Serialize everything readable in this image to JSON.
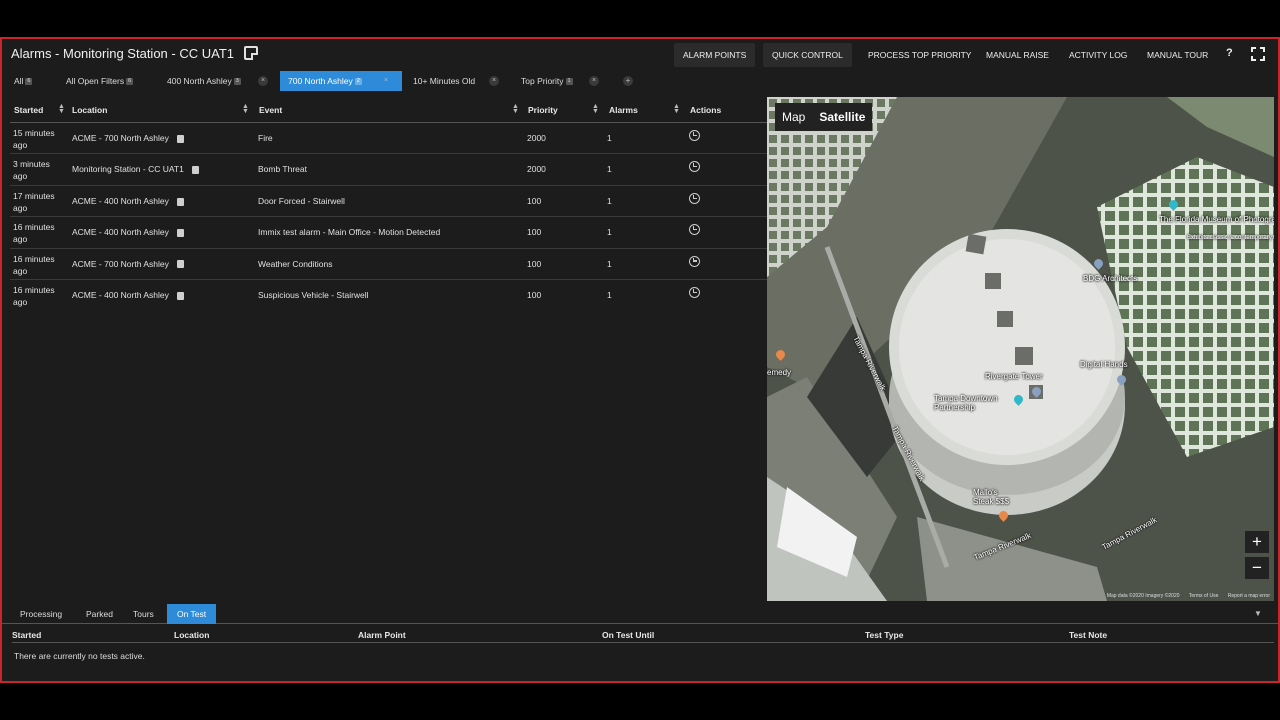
{
  "app": {
    "title": "Alarms - Monitoring Station - CC UAT1"
  },
  "header_buttons": {
    "alarm_points": "ALARM POINTS",
    "quick_control": "QUICK CONTROL",
    "process_top_priority": "PROCESS TOP PRIORITY",
    "manual_raise": "MANUAL RAISE",
    "activity_log": "ACTIVITY LOG",
    "manual_tour": "MANUAL TOUR",
    "help": "?"
  },
  "tabs": [
    {
      "label": "All",
      "count": "6",
      "closable": false,
      "active": false
    },
    {
      "label": "All Open Filters",
      "count": "6",
      "closable": false,
      "active": false
    },
    {
      "label": "400 North Ashley",
      "count": "3",
      "closable": true,
      "active": false
    },
    {
      "label": "700 North Ashley",
      "count": "2",
      "closable": true,
      "active": true
    },
    {
      "label": "10+ Minutes Old",
      "count": "",
      "closable": true,
      "active": false
    },
    {
      "label": "Top Priority",
      "count": "1",
      "closable": true,
      "active": false
    }
  ],
  "alarm_table": {
    "columns": [
      "Started",
      "Location",
      "Event",
      "Priority",
      "Alarms",
      "Actions"
    ],
    "rows": [
      {
        "started": "15 minutes ago",
        "location": "ACME - 700 North Ashley",
        "event": "Fire",
        "priority": "2000",
        "alarms": "1"
      },
      {
        "started": "3 minutes ago",
        "location": "Monitoring Station - CC UAT1",
        "event": "Bomb Threat",
        "priority": "2000",
        "alarms": "1"
      },
      {
        "started": "17 minutes ago",
        "location": "ACME - 400 North Ashley",
        "event": "Door Forced - Stairwell",
        "priority": "100",
        "alarms": "1"
      },
      {
        "started": "16 minutes ago",
        "location": "ACME - 400 North Ashley",
        "event": "Immix test alarm - Main Office - Motion Detected",
        "priority": "100",
        "alarms": "1"
      },
      {
        "started": "16 minutes ago",
        "location": "ACME - 700 North Ashley",
        "event": "Weather Conditions",
        "priority": "100",
        "alarms": "1"
      },
      {
        "started": "16 minutes ago",
        "location": "ACME - 400 North Ashley",
        "event": "Suspicious Vehicle - Stairwell",
        "priority": "100",
        "alarms": "1"
      }
    ]
  },
  "map": {
    "type_map": "Map",
    "type_satellite": "Satellite",
    "zoom_in": "+",
    "zoom_out": "−",
    "labels": {
      "museum": "The Florida Museum of Photographic Arts",
      "museum_sub": "Exhibits classic & contemporary works",
      "bdg": "BDG Architects",
      "digital_hands": "Digital Hands",
      "rivergate": "Rivergate Tower",
      "tampa_downtown": "Tampa Downtown Partnership",
      "mallos": "Mallo's Steak $$$",
      "riverwalk_1": "Tampa Riverwalk",
      "riverwalk_2": "Tampa Riverwalk",
      "road_1": "Tampa Riverwalk",
      "road_2": "Tampa Riverwalk",
      "edge_left": "emedy"
    },
    "footer": {
      "data": "Map data ©2020 Imagery ©2020",
      "terms": "Terms of Use",
      "report": "Report a map error"
    }
  },
  "bottom_tabs": [
    {
      "label": "Processing",
      "active": false
    },
    {
      "label": "Parked",
      "active": false
    },
    {
      "label": "Tours",
      "active": false
    },
    {
      "label": "On Test",
      "active": true
    }
  ],
  "test_table": {
    "columns": [
      "Started",
      "Location",
      "Alarm Point",
      "On Test Until",
      "Test Type",
      "Test Note"
    ],
    "empty_message": "There are currently no tests active."
  },
  "colors": {
    "accent": "#2d8bd9",
    "frame_border": "#c8262b",
    "background": "#1c1c1c"
  },
  "icons": [
    "note-icon",
    "help-icon",
    "fullscreen-icon",
    "sort-icon",
    "clock-icon",
    "close-icon",
    "add-icon",
    "map-pin-icon",
    "chevron-down-icon"
  ]
}
